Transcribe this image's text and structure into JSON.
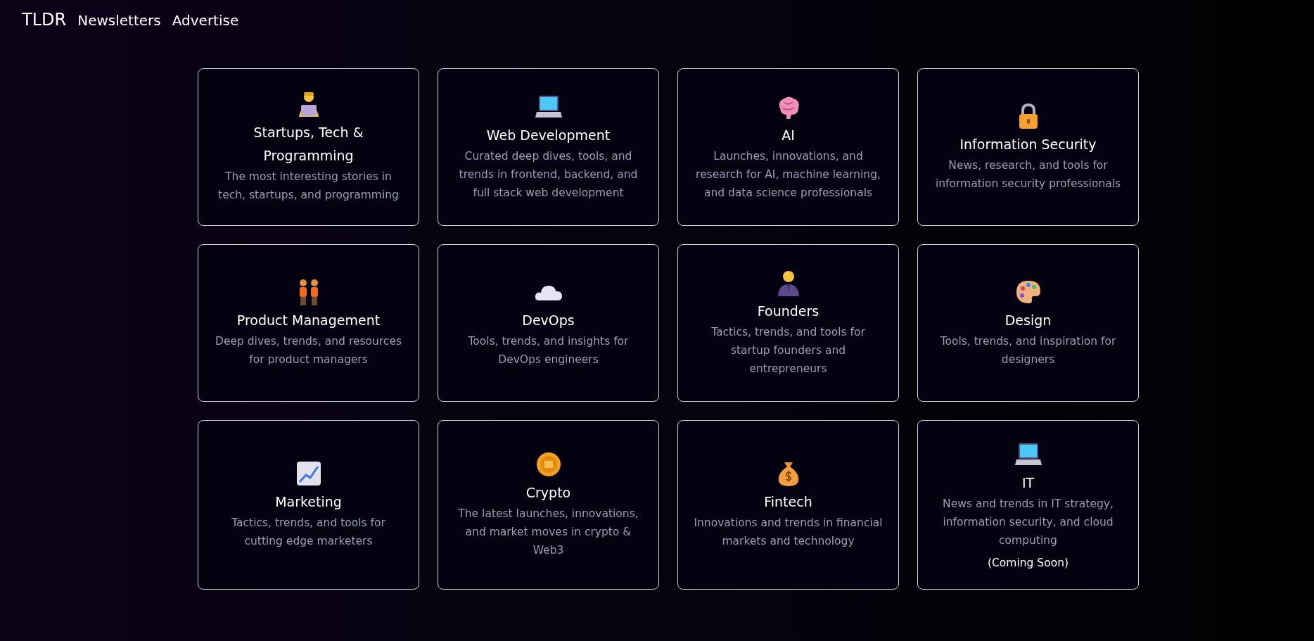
{
  "nav": {
    "logo": "TLDR",
    "links": [
      "Newsletters",
      "Advertise"
    ]
  },
  "cards": [
    {
      "title": "Startups, Tech & Programming",
      "description": "The most interesting stories in tech, startups, and programming"
    },
    {
      "title": "Web Development",
      "description": "Curated deep dives, tools, and trends in frontend, backend, and full stack web development"
    },
    {
      "title": "AI",
      "description": "Launches, innovations, and research for AI, machine learning, and data science professionals"
    },
    {
      "title": "Information Security",
      "description": "News, research, and tools for information security professionals"
    },
    {
      "title": "Product Management",
      "description": "Deep dives, trends, and resources for product managers"
    },
    {
      "title": "DevOps",
      "description": "Tools, trends, and insights for DevOps engineers"
    },
    {
      "title": "Founders",
      "description": "Tactics, trends, and tools for startup founders and entrepreneurs"
    },
    {
      "title": "Design",
      "description": "Tools, trends, and inspiration for designers"
    },
    {
      "title": "Marketing",
      "description": "Tactics, trends, and tools for cutting edge marketers"
    },
    {
      "title": "Crypto",
      "description": "The latest launches, innovations, and market moves in crypto & Web3"
    },
    {
      "title": "Fintech",
      "description": "Innovations and trends in financial markets and technology"
    },
    {
      "title": "IT",
      "description": "News and trends in IT strategy, information security, and cloud computing",
      "note": "(Coming Soon)"
    }
  ]
}
